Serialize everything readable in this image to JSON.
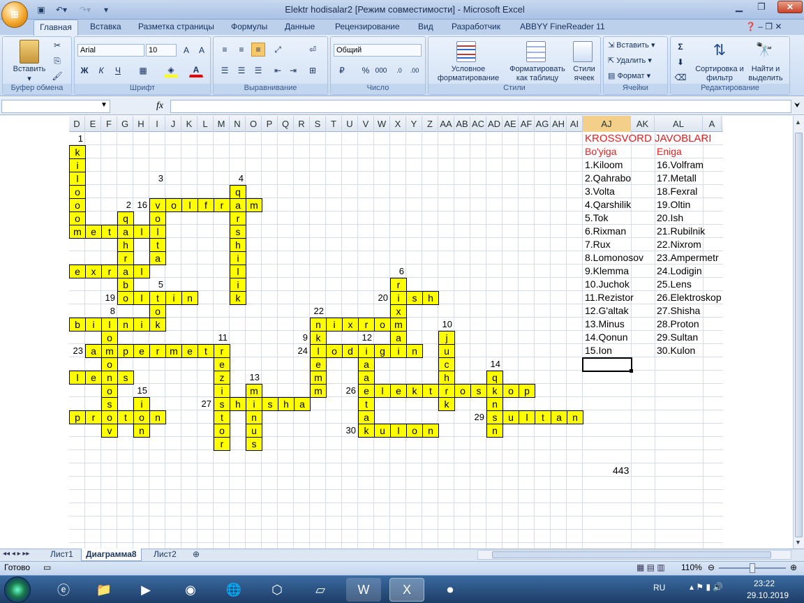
{
  "window": {
    "title": "Elektr hodisalar2  [Режим совместимости] - Microsoft Excel",
    "office_button": "office-orb"
  },
  "tabs": [
    "Главная",
    "Вставка",
    "Разметка страницы",
    "Формулы",
    "Данные",
    "Рецензирование",
    "Вид",
    "Разработчик",
    "ABBYY FineReader 11"
  ],
  "ribbon": {
    "clipboard": {
      "paste": "Вставить",
      "label": "Буфер обмена"
    },
    "font": {
      "name": "Arial",
      "size": "10",
      "label": "Шрифт",
      "bold": "Ж",
      "italic": "К",
      "underline": "Ч"
    },
    "alignment": {
      "label": "Выравнивание"
    },
    "number": {
      "format": "Общий",
      "label": "Число",
      "percent": "%",
      "thousands": "000"
    },
    "styles": {
      "cond_format": "Условное форматирование",
      "format_table": "Форматировать как таблицу",
      "cell_styles": "Стили ячеек",
      "label": "Стили"
    },
    "cells": {
      "insert": "Вставить",
      "delete": "Удалить",
      "format": "Формат",
      "label": "Ячейки"
    },
    "editing": {
      "sort": "Сортировка и фильтр",
      "find": "Найти и выделить",
      "label": "Редактирование",
      "sigma": "Σ"
    }
  },
  "formula_bar": {
    "fx": "fx",
    "name_box": "",
    "content": ""
  },
  "columns": [
    "D",
    "E",
    "F",
    "G",
    "H",
    "I",
    "J",
    "K",
    "L",
    "M",
    "N",
    "O",
    "P",
    "Q",
    "R",
    "S",
    "T",
    "U",
    "V",
    "W",
    "X",
    "Y",
    "Z",
    "AA",
    "AB",
    "AC",
    "AD",
    "AE",
    "AF",
    "AG",
    "AH",
    "AI",
    "AJ",
    "AK",
    "AL",
    "A"
  ],
  "crossword": {
    "title": "KROSSVORD JAVOBLARI",
    "across_header": "Bo'yiga",
    "down_header": "Eniga",
    "across": [
      "1.Kiloom",
      "2.Qahrabo",
      "3.Volta",
      "4.Qarshilik",
      "5.Tok",
      "6.Rixman",
      "7.Rux",
      "8.Lomonosov",
      "9.Klemma",
      "10.Juchok",
      "11.Rezistor",
      "12.G'altak",
      "13.Minus",
      "14.Qonun",
      "15.Ion"
    ],
    "down": [
      "16.Volfram",
      "17.Metall",
      "18.Fexral",
      "19.Oltin",
      "20.Ish",
      "21.Rubilnik",
      "22.Nixrom",
      "23.Ampermetr",
      "24.Lodigin",
      "25.Lens",
      "26.Elektroskop",
      "27.Shisha",
      "28.Proton",
      "29.Sultan",
      "30.Kulon"
    ],
    "extra_value": "443"
  },
  "sheets": [
    "Лист1",
    "Диаграмма8",
    "Лист2"
  ],
  "status": {
    "ready": "Готово",
    "zoom": "110%"
  },
  "taskbar": {
    "lang": "RU",
    "time": "23:22",
    "date": "29.10.2019"
  }
}
